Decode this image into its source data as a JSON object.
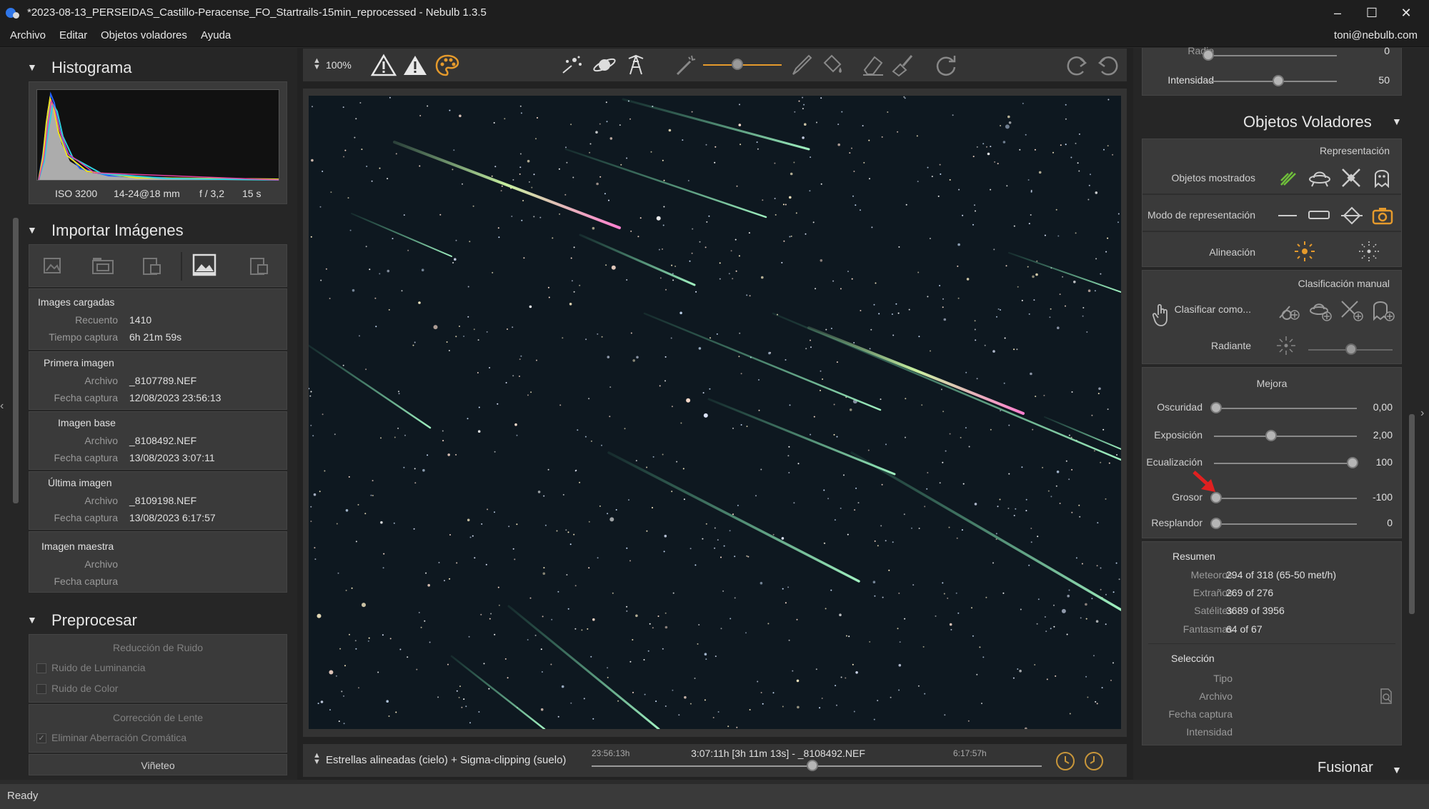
{
  "window": {
    "title": "*2023-08-13_PERSEIDAS_Castillo-Peracense_FO_Startrails-15min_reprocessed - Nebulb 1.3.5"
  },
  "menubar": {
    "items": [
      "Archivo",
      "Editar",
      "Objetos voladores",
      "Ayuda"
    ],
    "user": "toni@nebulb.com"
  },
  "histogram": {
    "title": "Histograma",
    "iso": "ISO 3200",
    "lens": "14-24@18 mm",
    "aperture": "f / 3,2",
    "exposure": "15 s"
  },
  "import": {
    "title": "Importar Imágenes",
    "loaded": {
      "group": "Images cargadas",
      "count_label": "Recuento",
      "count": "1410",
      "time_label": "Tiempo captura",
      "time": "6h 21m 59s"
    },
    "first": {
      "group": "Primera imagen",
      "file_label": "Archivo",
      "file": "_8107789.NEF",
      "date_label": "Fecha captura",
      "date": "12/08/2023 23:56:13"
    },
    "base": {
      "group": "Imagen base",
      "file_label": "Archivo",
      "file": "_8108492.NEF",
      "date_label": "Fecha captura",
      "date": "13/08/2023 3:07:11"
    },
    "last": {
      "group": "Última imagen",
      "file_label": "Archivo",
      "file": "_8109198.NEF",
      "date_label": "Fecha captura",
      "date": "13/08/2023 6:17:57"
    },
    "master": {
      "group": "Imagen maestra",
      "file_label": "Archivo",
      "date_label": "Fecha captura"
    }
  },
  "preprocess": {
    "title": "Preprocesar",
    "noise_group": "Reducción de Ruido",
    "luminance": "Ruido de Luminancia",
    "color": "Ruido de Color",
    "lens_group": "Corrección de Lente",
    "chromatic": "Eliminar Aberración Cromática",
    "vignette": "Viñeteo"
  },
  "toolbar": {
    "zoom": "100%"
  },
  "bottombar": {
    "mode": "Estrellas alineadas (cielo) + Sigma-clipping (suelo)",
    "start_time": "23:56:13h",
    "current": "3:07:11h [3h 11m 13s] - _8108492.NEF",
    "end_time": "6:17:57h",
    "timeline_position": 0.49
  },
  "right": {
    "top": {
      "radio_label": "Radio",
      "radio_value": "0",
      "intensity_label": "Intensidad",
      "intensity_value": "50"
    },
    "flying": {
      "title": "Objetos Voladores",
      "representation": "Representación",
      "shown": "Objetos mostrados",
      "mode": "Modo de representación",
      "align": "Alineación",
      "manual": "Clasificación manual",
      "classify": "Clasificar como...",
      "radiant": "Radiante"
    },
    "enhance": {
      "title": "Mejora",
      "darkness_label": "Oscuridad",
      "darkness_value": "0,00",
      "exposure_label": "Exposición",
      "exposure_value": "2,00",
      "equalization_label": "Ecualización",
      "equalization_value": "100",
      "thickness_label": "Grosor",
      "thickness_value": "-100",
      "glow_label": "Resplandor",
      "glow_value": "0"
    },
    "summary": {
      "title": "Resumen",
      "meteors_label": "Meteoros",
      "meteors": "294 of 318 (65-50 met/h)",
      "strange_label": "Extraños",
      "strange": "269 of 276",
      "satellites_label": "Satélites",
      "satellites": "3689 of 3956",
      "ghosts_label": "Fantasmas",
      "ghosts": "64 of 67"
    },
    "selection": {
      "title": "Selección",
      "type_label": "Tipo",
      "file_label": "Archivo",
      "date_label": "Fecha captura",
      "intensity_label": "Intensidad"
    },
    "merge": "Fusionar"
  },
  "status": "Ready",
  "colors": {
    "accent_orange": "#e59a2c",
    "accent_green": "#6fbf3a",
    "arrow_red": "#e02020"
  }
}
